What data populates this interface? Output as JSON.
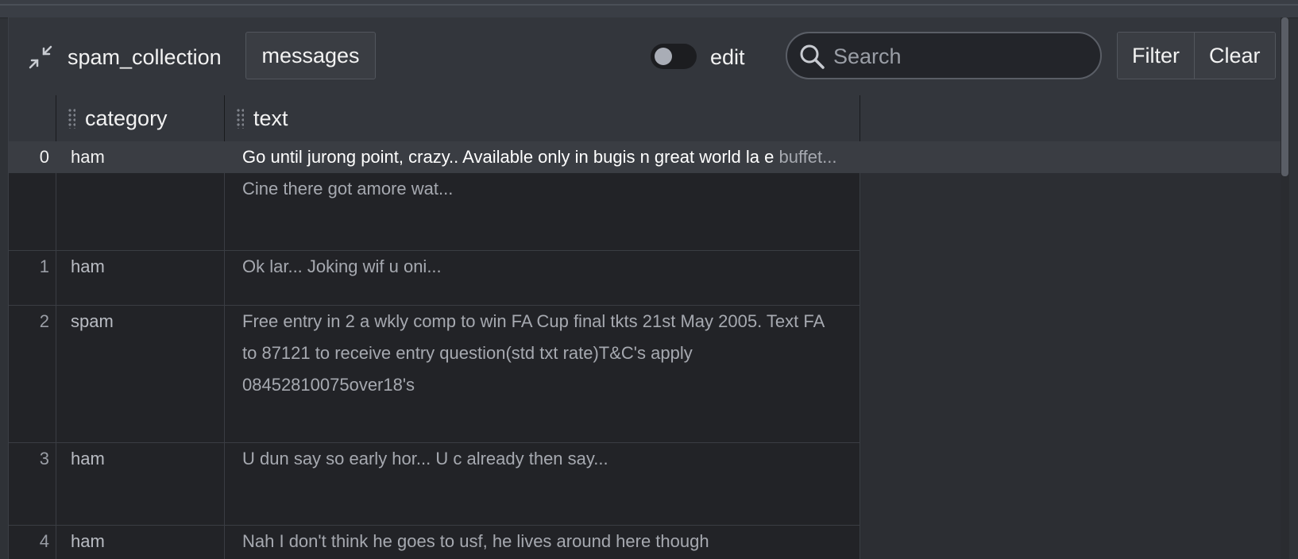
{
  "toolbar": {
    "title": "spam_collection",
    "tab_label": "messages",
    "toggle_label": "edit",
    "toggle_on": false,
    "search_placeholder": "Search",
    "filter_label": "Filter",
    "clear_label": "Clear"
  },
  "grid": {
    "columns": [
      "category",
      "text"
    ],
    "rows": [
      {
        "index": "0",
        "category": "ham",
        "text_first": "Go until jurong point, crazy.. Available only in bugis n great world la e",
        "text_rest": "buffet... Cine there got amore wat..."
      },
      {
        "index": "1",
        "category": "ham",
        "text_first": "Ok lar... Joking wif u oni...",
        "text_rest": ""
      },
      {
        "index": "2",
        "category": "spam",
        "text_first": "Free entry in 2 a wkly comp to win FA Cup final tkts 21st May 2005.",
        "text_rest": "Text FA to 87121 to receive entry question(std txt rate)T&C's apply 08452810075over18's"
      },
      {
        "index": "3",
        "category": "ham",
        "text_first": "U dun say so early hor... U c already then say...",
        "text_rest": ""
      },
      {
        "index": "4",
        "category": "ham",
        "text_first": "Nah I don't think he goes to usf, he lives around here though",
        "text_rest": ""
      }
    ]
  },
  "colors": {
    "background": "#222327",
    "toolbar": "#33363c",
    "highlight_row": "#3a3d43"
  }
}
